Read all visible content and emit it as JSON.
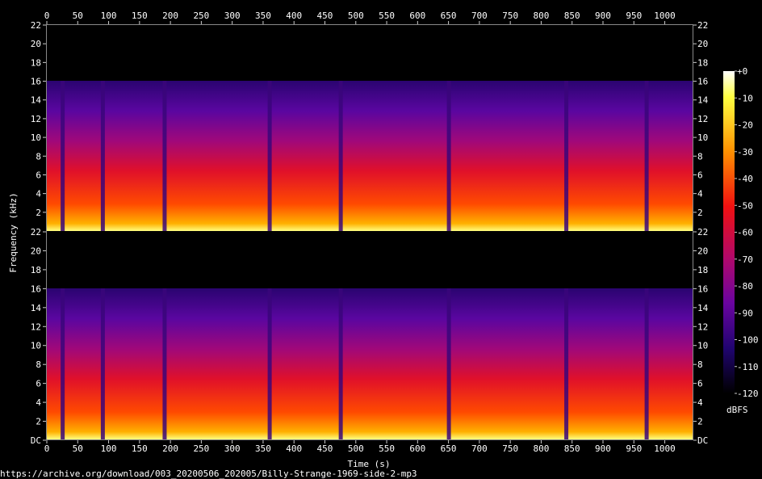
{
  "source_label": "https://archive.org/download/003_20200506_202005/Billy-Strange-1969-side-2-mp3",
  "chart_data": {
    "type": "heatmap",
    "title": "",
    "xlabel": "Time (s)",
    "ylabel": "Frequency (kHz)",
    "x_ticks": [
      "0",
      "50",
      "100",
      "150",
      "200",
      "250",
      "300",
      "350",
      "400",
      "450",
      "500",
      "550",
      "600",
      "650",
      "700",
      "750",
      "800",
      "850",
      "900",
      "950",
      "1000"
    ],
    "x_range": [
      0,
      1045
    ],
    "y_ticks_upper": [
      "22",
      "20",
      "18",
      "16",
      "14",
      "12",
      "10",
      "8",
      "6",
      "4",
      "2"
    ],
    "y_ticks_lower": [
      "22",
      "20",
      "18",
      "16",
      "14",
      "12",
      "10",
      "8",
      "6",
      "4",
      "2",
      "DC"
    ],
    "y_range_khz": [
      0,
      22
    ],
    "channels": 2,
    "bandwidth_limit_khz": 16,
    "colorbar": {
      "label": "dBFS",
      "ticks": [
        "+0",
        "-10",
        "-20",
        "-30",
        "-40",
        "-50",
        "-60",
        "-70",
        "-80",
        "-90",
        "-100",
        "-110",
        "-120"
      ],
      "range": [
        -120,
        0
      ]
    },
    "track_gaps_s": [
      25,
      90,
      190,
      360,
      475,
      650,
      840,
      970
    ]
  }
}
